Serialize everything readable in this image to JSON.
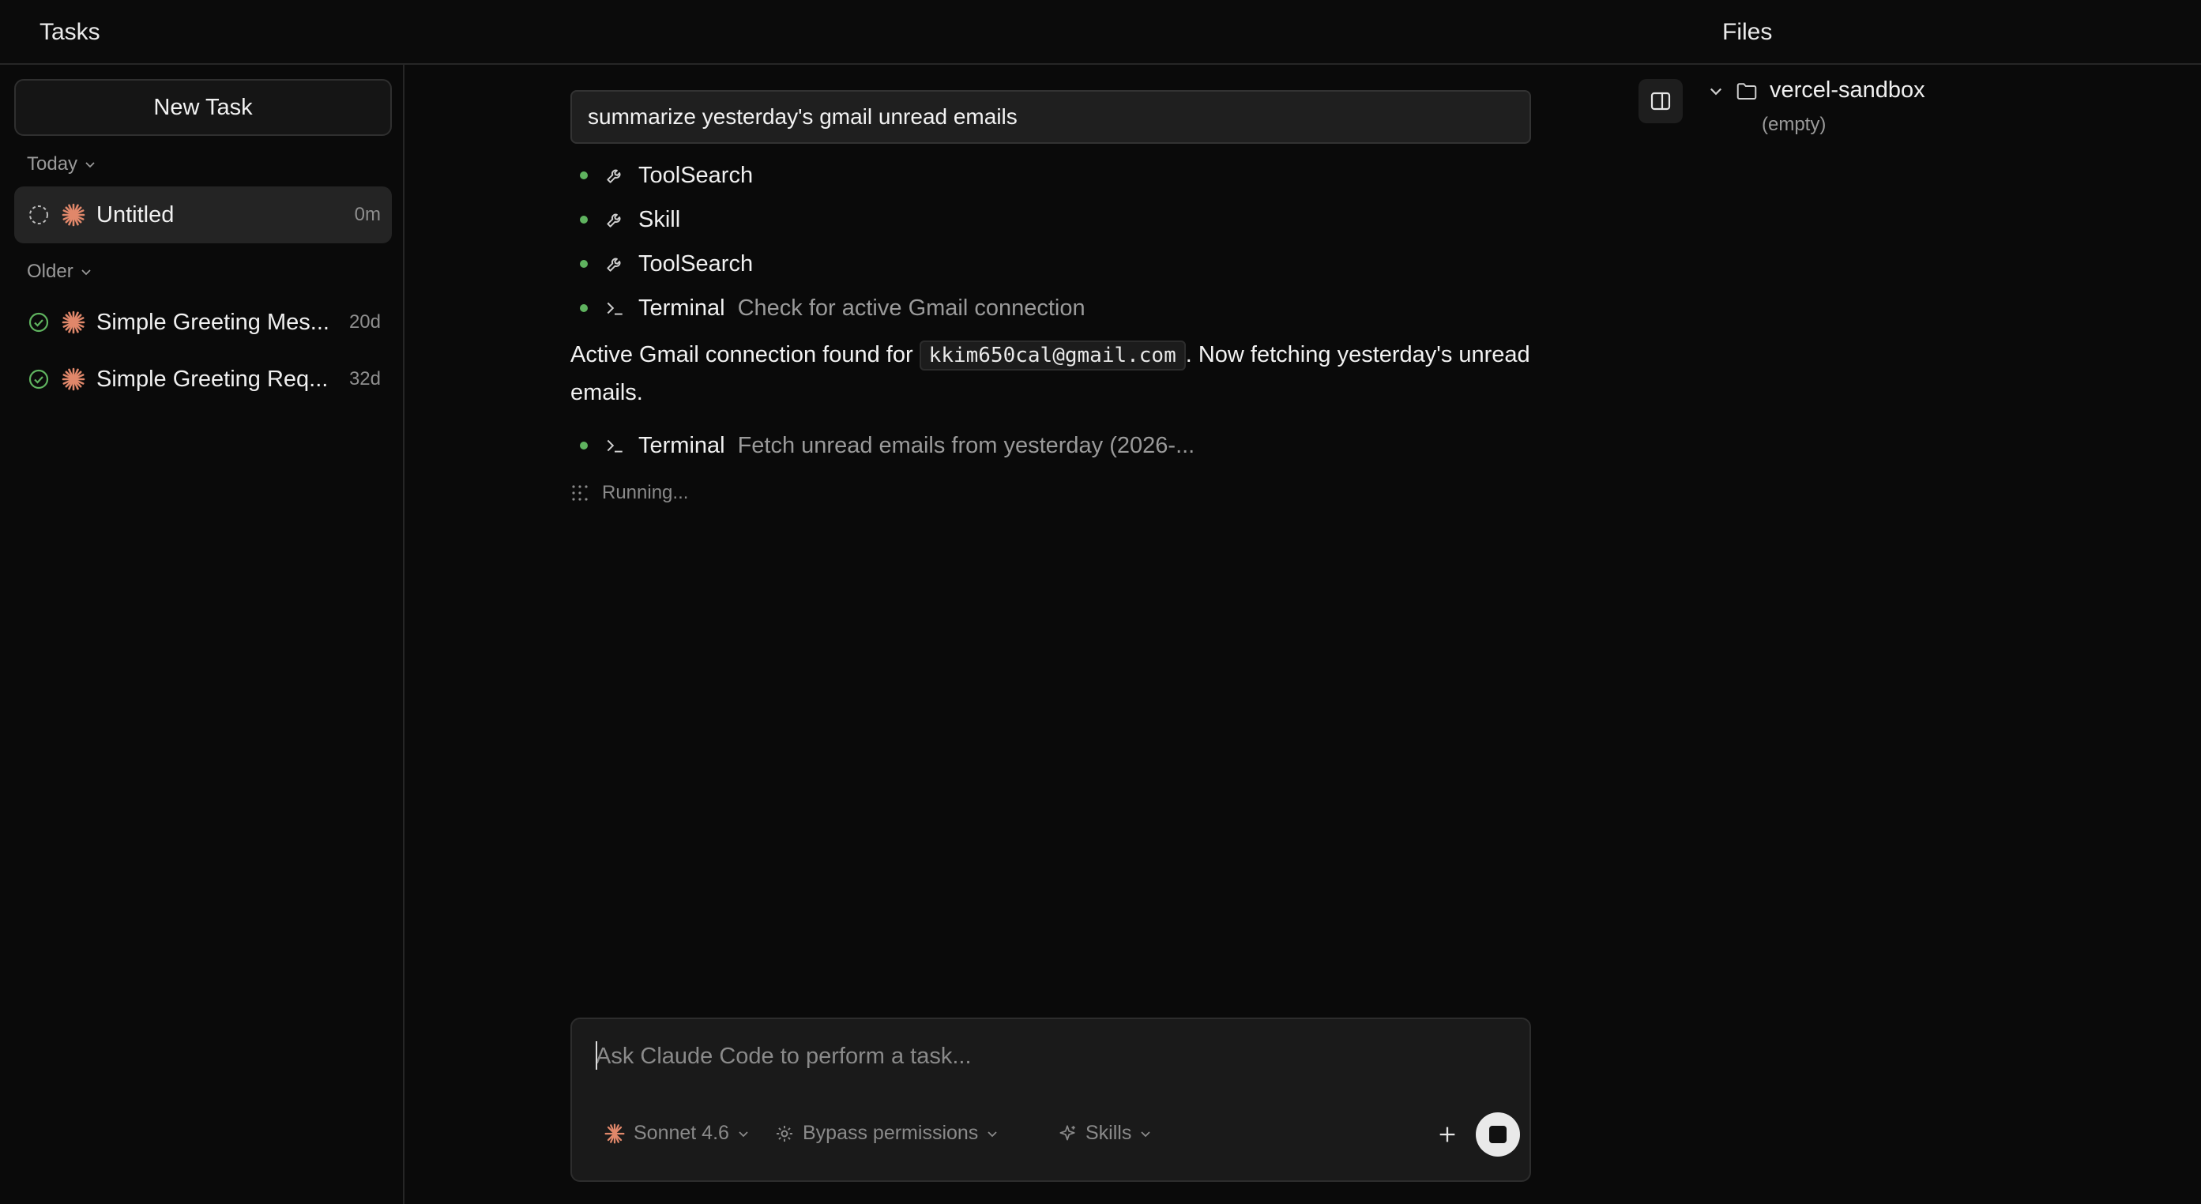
{
  "header": {
    "tasks_title": "Tasks",
    "files_title": "Files"
  },
  "sidebar": {
    "new_task_label": "New Task",
    "groups": [
      {
        "label": "Today"
      },
      {
        "label": "Older"
      }
    ],
    "tasks": [
      {
        "name": "Untitled",
        "age": "0m",
        "status": "in-progress",
        "active": true
      },
      {
        "name": "Simple Greeting Mes...",
        "age": "20d",
        "status": "done"
      },
      {
        "name": "Simple Greeting Req...",
        "age": "32d",
        "status": "done"
      }
    ]
  },
  "main": {
    "prompt": "summarize yesterday's gmail unread emails",
    "steps": [
      {
        "tool": "ToolSearch",
        "icon": "wrench-icon",
        "desc": ""
      },
      {
        "tool": "Skill",
        "icon": "wrench-icon",
        "desc": ""
      },
      {
        "tool": "ToolSearch",
        "icon": "wrench-icon",
        "desc": ""
      },
      {
        "tool": "Terminal",
        "icon": "terminal-icon",
        "desc": "Check for active Gmail connection"
      },
      {
        "tool": "Terminal",
        "icon": "terminal-icon",
        "desc": "Fetch unread emails from yesterday (2026-..."
      }
    ],
    "message": {
      "before": "Active Gmail connection found for ",
      "email": "kkim650cal@gmail.com",
      "after": ". Now fetching yesterday's unread emails."
    },
    "running_label": "Running..."
  },
  "composer": {
    "placeholder": "Ask Claude Code to perform a task...",
    "model_label": "Sonnet 4.6",
    "permissions_label": "Bypass permissions",
    "skills_label": "Skills"
  },
  "files": {
    "folder_name": "vercel-sandbox",
    "empty_label": "(empty)"
  },
  "colors": {
    "background": "#0a0a0a",
    "accent_orange": "#e0876a",
    "status_green": "#5fb35f"
  }
}
